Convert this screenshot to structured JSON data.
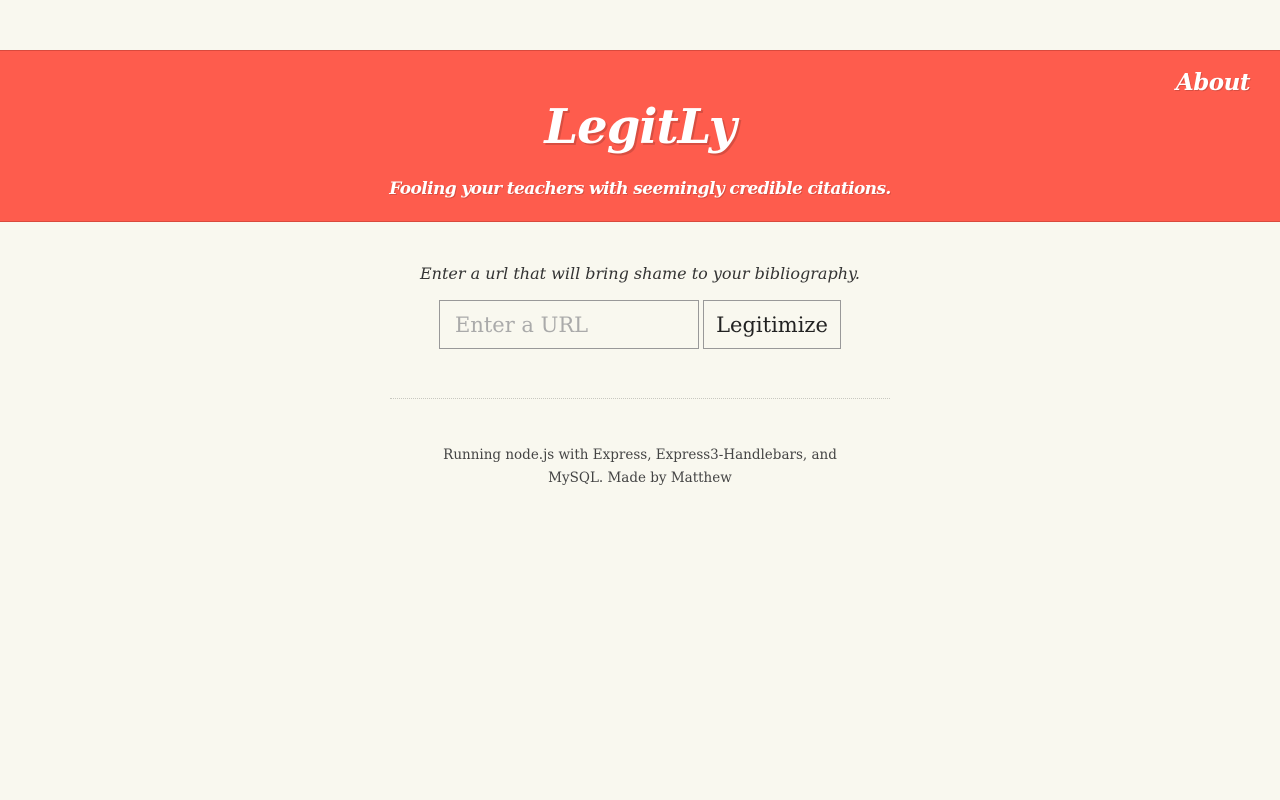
{
  "header": {
    "about_label": "About",
    "title": "LegitLy",
    "tagline": "Fooling your teachers with seemingly credible citations."
  },
  "form": {
    "prompt": "Enter a url that will bring shame to your bibliography.",
    "url_placeholder": "Enter a URL",
    "url_value": "",
    "submit_label": "Legitimize"
  },
  "footer": {
    "text": "Running node.js with Express, Express3-Handlebars, and MySQL. Made by Matthew"
  },
  "colors": {
    "header_background": "#fe5c4d",
    "page_background": "#f9f8ef"
  }
}
